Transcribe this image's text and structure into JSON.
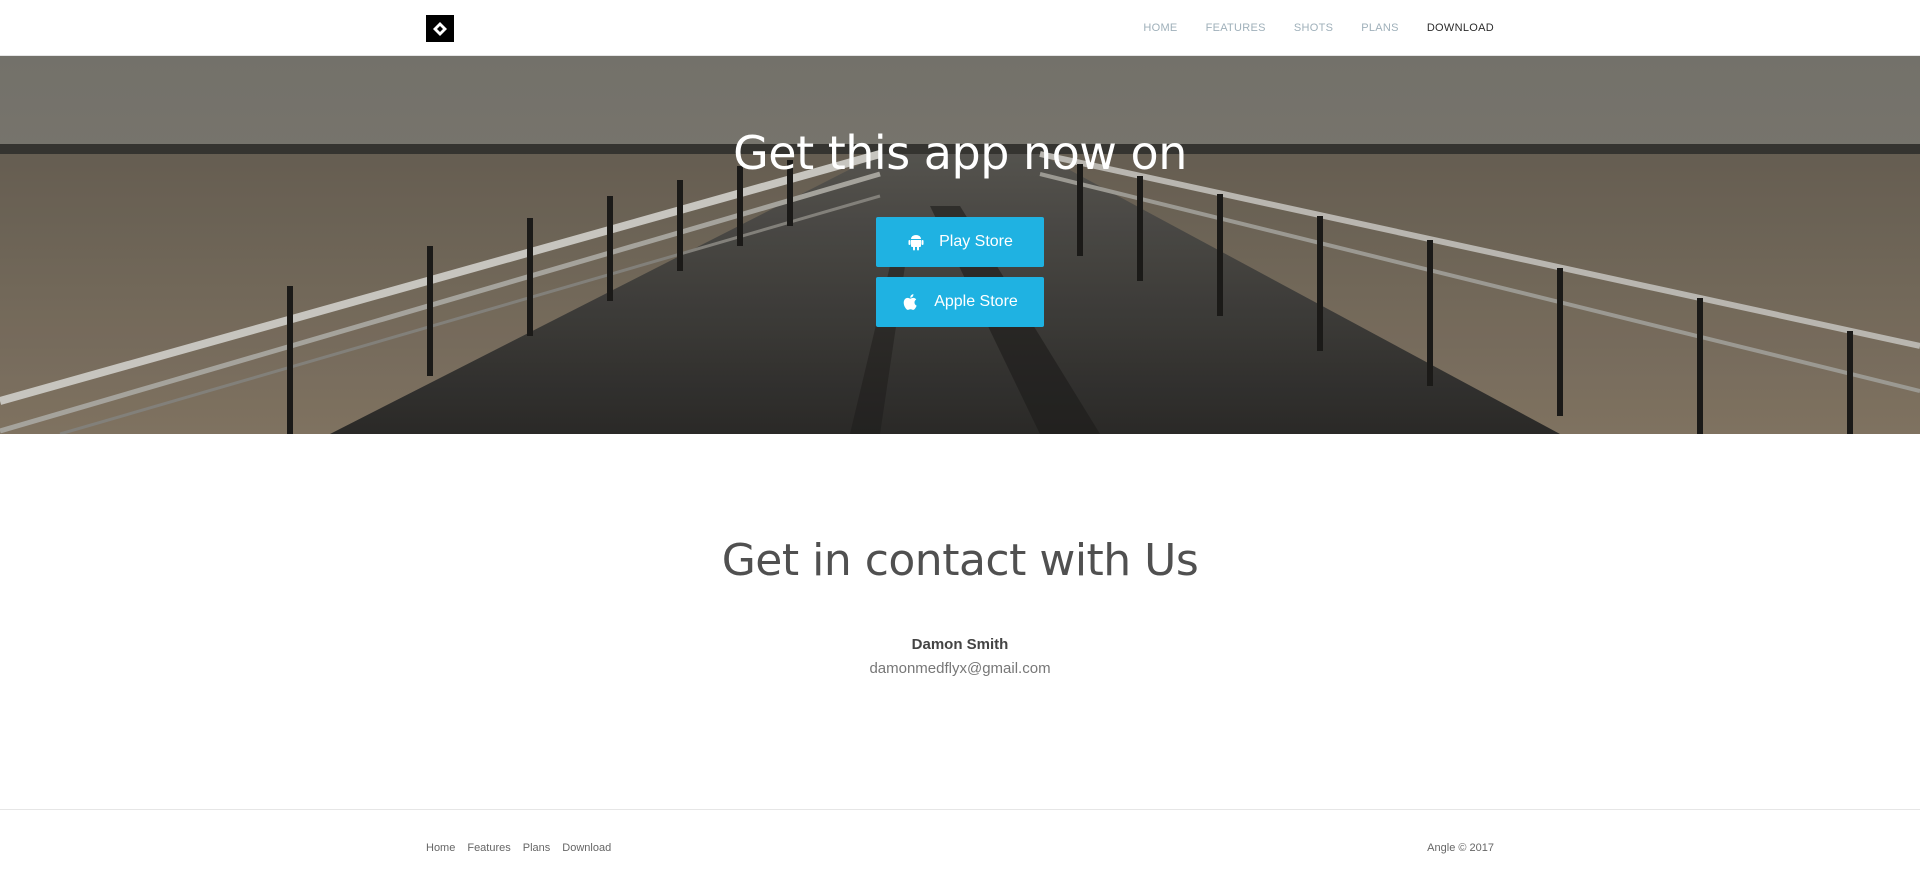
{
  "nav": {
    "logo_icon": "diamond-logo-icon",
    "items": [
      {
        "label": "HOME",
        "active": false
      },
      {
        "label": "FEATURES",
        "active": false
      },
      {
        "label": "SHOTS",
        "active": false
      },
      {
        "label": "PLANS",
        "active": false
      },
      {
        "label": "DOWNLOAD",
        "active": true
      }
    ]
  },
  "hero": {
    "title": "Get this app now on",
    "play_store_label": "Play Store",
    "play_store_icon": "android-icon",
    "apple_store_label": "Apple Store",
    "apple_store_icon": "apple-icon",
    "button_color": "#1fb2e2"
  },
  "contact": {
    "title": "Get in contact with Us",
    "name": "Damon Smith",
    "email": "damonmedflyx@gmail.com"
  },
  "footer": {
    "links": [
      "Home",
      "Features",
      "Plans",
      "Download"
    ],
    "copyright": "Angle © 2017"
  }
}
